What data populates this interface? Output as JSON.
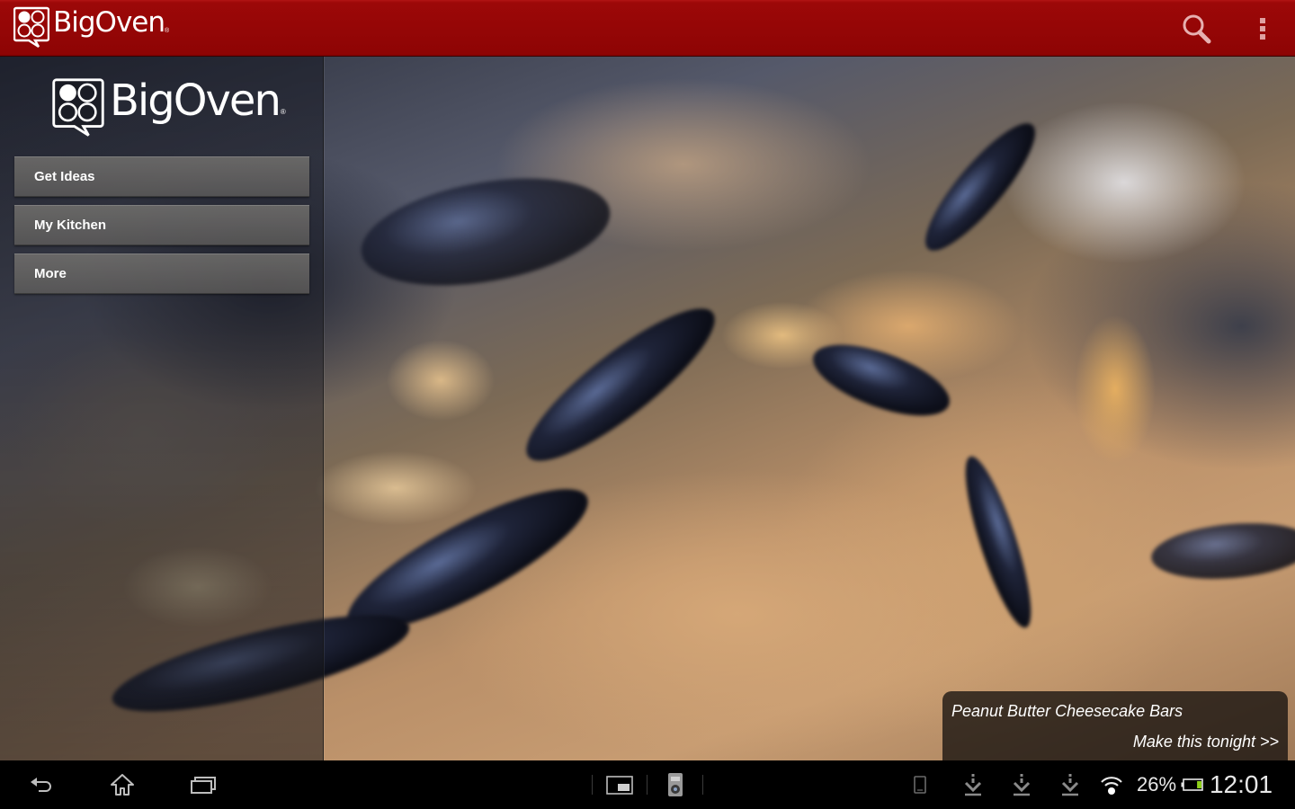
{
  "app": {
    "name": "BigOven",
    "registered_mark": "®"
  },
  "action_bar": {
    "logo_text": "BigOven",
    "icons": {
      "search": "search-icon",
      "overflow": "overflow-menu-icon"
    },
    "colors": {
      "background": "#8e0404"
    }
  },
  "sidebar": {
    "logo_text": "BigOven",
    "items": [
      {
        "label": "Get Ideas"
      },
      {
        "label": "My Kitchen"
      },
      {
        "label": "More"
      }
    ]
  },
  "featured_recipe": {
    "title": "Peanut Butter Cheesecake Bars",
    "cta": "Make this tonight >>"
  },
  "system_bar": {
    "nav": [
      "back-icon",
      "home-icon",
      "recent-apps-icon"
    ],
    "quick_apps": [
      "screenshot-icon",
      "remote-control-icon"
    ],
    "notifications": [
      "device-icon",
      "download-icon",
      "download-icon",
      "download-icon"
    ],
    "battery_percent": "26%",
    "battery_level": 0.26,
    "clock": "12:01",
    "colors": {
      "battery_fill": "#8fd11a"
    }
  }
}
